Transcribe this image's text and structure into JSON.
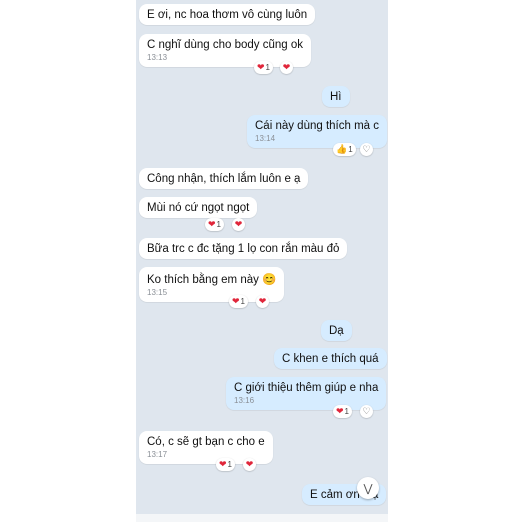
{
  "messages": [
    {
      "text": "E ơi, nc hoa thơm vô cùng luôn"
    },
    {
      "text": "C nghĩ dùng cho body cũng ok",
      "time": "13:13"
    },
    {
      "text": "Hì"
    },
    {
      "text": "Cái này dùng thích mà c",
      "time": "13:14"
    },
    {
      "text": "Công nhận, thích lắm luôn e ạ"
    },
    {
      "text": "Mùi nó cứ ngọt ngọt"
    },
    {
      "text": "Bữa trc c đc tặng 1 lọ con rắn màu đỏ"
    },
    {
      "text": "Ko thích bằng em này 😊",
      "time": "13:15"
    },
    {
      "text": "Dạ"
    },
    {
      "text": "C khen e thích quá"
    },
    {
      "text": "C giới thiệu thêm giúp e nha",
      "time": "13:16"
    },
    {
      "text": "Có, c sẽ gt bạn c cho e",
      "time": "13:17"
    },
    {
      "text": "E cảm ơn c ạ"
    }
  ],
  "reactions": {
    "count_1": "1"
  },
  "icons": {
    "heart": "heart-icon",
    "heart_outline": "heart-outline-icon",
    "thumbs_up": "thumbs-up-icon",
    "scroll_down": "double-chevron-down-icon"
  },
  "colors": {
    "chat_bg": "#dfe6ee",
    "incoming_bubble": "#ffffff",
    "outgoing_bubble": "#d6ecff",
    "heart": "#e0263a"
  }
}
